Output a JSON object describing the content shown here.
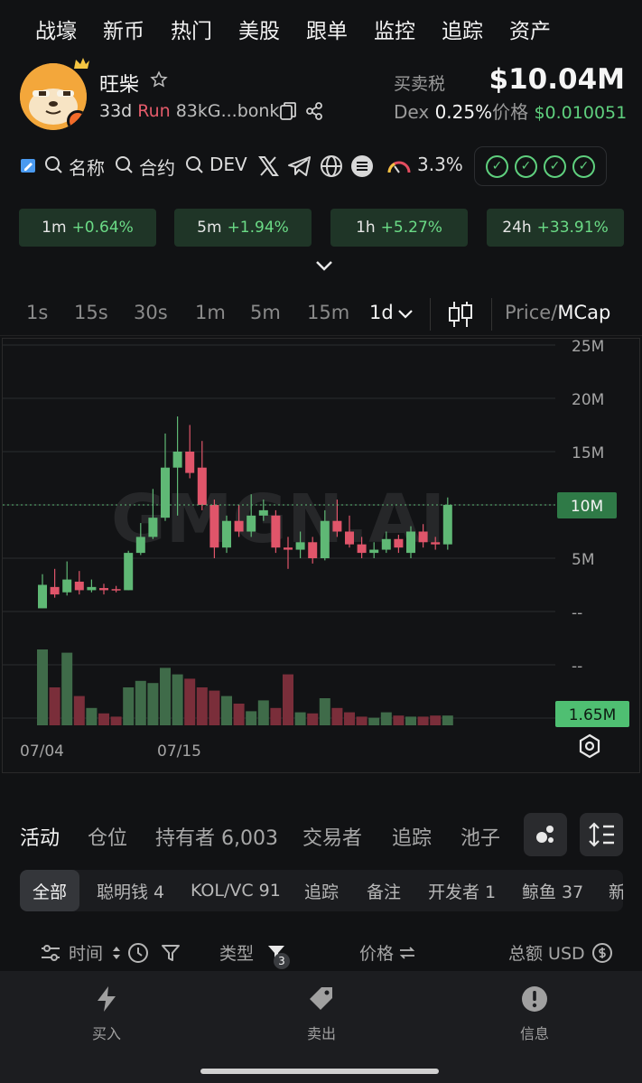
{
  "nav": [
    "战壕",
    "新币",
    "热门",
    "美股",
    "跟单",
    "监控",
    "追踪",
    "资产"
  ],
  "token": {
    "name": "旺柴",
    "age": "33d",
    "status": "Run",
    "address": "83kG...bonk",
    "tax_label": "买卖税",
    "market_cap": "$10.04M",
    "dex_label": "Dex",
    "dex_tax": "0.25%",
    "price_label": "价格",
    "price": "$0.010051"
  },
  "links": {
    "search_name": "名称",
    "search_contract": "合约",
    "search_dev": "DEV",
    "risk_pct": "3.3%",
    "checks": [
      "✓",
      "✓",
      "✓",
      "✓"
    ]
  },
  "changes": [
    {
      "tf": "1m",
      "val": "+0.64%"
    },
    {
      "tf": "5m",
      "val": "+1.94%"
    },
    {
      "tf": "1h",
      "val": "+5.27%"
    },
    {
      "tf": "24h",
      "val": "+33.91%"
    }
  ],
  "timeframes": [
    "1s",
    "15s",
    "30s",
    "1m",
    "5m",
    "15m",
    "1d"
  ],
  "price_toggle": {
    "price": "Price/",
    "mcap": "MCap"
  },
  "chart_data": {
    "type": "candlestick",
    "watermark": "GMGN.AI",
    "y_ticks": [
      "25M",
      "20M",
      "15M",
      "10M",
      "5M",
      "--",
      "--"
    ],
    "current_label": "10M",
    "volume_label": "1.65M",
    "x_ticks": [
      "07/04",
      "07/15"
    ],
    "ylim": [
      -5,
      26
    ],
    "candles": [
      {
        "o": 0.3,
        "c": 2.5,
        "h": 3.5,
        "l": 0.3
      },
      {
        "o": 2.3,
        "c": 1.6,
        "h": 4.0,
        "l": 1.3
      },
      {
        "o": 1.8,
        "c": 3.0,
        "h": 4.7,
        "l": 1.5
      },
      {
        "o": 2.8,
        "c": 2.0,
        "h": 3.8,
        "l": 1.6
      },
      {
        "o": 2.0,
        "c": 2.3,
        "h": 3.0,
        "l": 1.8
      },
      {
        "o": 2.2,
        "c": 2.0,
        "h": 2.6,
        "l": 1.6
      },
      {
        "o": 2.1,
        "c": 2.0,
        "h": 2.4,
        "l": 1.8
      },
      {
        "o": 2.0,
        "c": 5.5,
        "h": 5.7,
        "l": 2.0
      },
      {
        "o": 5.5,
        "c": 7.0,
        "h": 8.3,
        "l": 5.3
      },
      {
        "o": 7.0,
        "c": 8.8,
        "h": 11.5,
        "l": 6.8
      },
      {
        "o": 8.8,
        "c": 13.5,
        "h": 16.7,
        "l": 8.5
      },
      {
        "o": 13.5,
        "c": 15.0,
        "h": 18.3,
        "l": 9.0
      },
      {
        "o": 15.0,
        "c": 13.0,
        "h": 17.5,
        "l": 12.5
      },
      {
        "o": 13.5,
        "c": 10.0,
        "h": 16.0,
        "l": 9.5
      },
      {
        "o": 10.0,
        "c": 6.0,
        "h": 10.5,
        "l": 5.0
      },
      {
        "o": 6.0,
        "c": 8.5,
        "h": 9.0,
        "l": 5.5
      },
      {
        "o": 8.5,
        "c": 7.5,
        "h": 10.0,
        "l": 7.0
      },
      {
        "o": 7.5,
        "c": 9.0,
        "h": 11.0,
        "l": 7.0
      },
      {
        "o": 9.0,
        "c": 9.5,
        "h": 10.5,
        "l": 8.5
      },
      {
        "o": 9.0,
        "c": 6.0,
        "h": 9.5,
        "l": 5.5
      },
      {
        "o": 6.0,
        "c": 5.8,
        "h": 7.0,
        "l": 4.0
      },
      {
        "o": 5.8,
        "c": 6.5,
        "h": 7.5,
        "l": 5.0
      },
      {
        "o": 6.5,
        "c": 5.0,
        "h": 7.0,
        "l": 4.5
      },
      {
        "o": 5.0,
        "c": 8.5,
        "h": 9.5,
        "l": 4.8
      },
      {
        "o": 8.5,
        "c": 7.5,
        "h": 10.5,
        "l": 7.0
      },
      {
        "o": 7.5,
        "c": 6.3,
        "h": 9.0,
        "l": 6.0
      },
      {
        "o": 6.3,
        "c": 5.5,
        "h": 7.0,
        "l": 5.0
      },
      {
        "o": 5.5,
        "c": 5.8,
        "h": 6.5,
        "l": 5.0
      },
      {
        "o": 5.8,
        "c": 6.8,
        "h": 7.5,
        "l": 5.5
      },
      {
        "o": 6.8,
        "c": 6.0,
        "h": 7.2,
        "l": 5.5
      },
      {
        "o": 5.5,
        "c": 7.5,
        "h": 8.0,
        "l": 5.0
      },
      {
        "o": 7.5,
        "c": 6.5,
        "h": 8.2,
        "l": 6.0
      },
      {
        "o": 6.5,
        "c": 6.3,
        "h": 7.0,
        "l": 5.8
      },
      {
        "o": 6.3,
        "c": 10.0,
        "h": 10.7,
        "l": 5.8
      }
    ],
    "volumes": [
      7,
      3.5,
      6.7,
      2.7,
      1.6,
      1.1,
      0.8,
      3.5,
      4.1,
      3.9,
      5.3,
      4.7,
      4.3,
      3.5,
      3.2,
      2.7,
      2.0,
      1.3,
      2.3,
      1.6,
      4.7,
      1.2,
      1.1,
      2.5,
      1.6,
      1.2,
      0.8,
      0.7,
      1.2,
      0.9,
      0.8,
      0.8,
      0.9,
      0.9
    ]
  },
  "tabs": {
    "activity": "活动",
    "positions": "仓位",
    "holders": "持有者 6,003",
    "traders": "交易者",
    "tracking": "追踪",
    "pools": "池子"
  },
  "filters": [
    "全部",
    "聪明钱 4",
    "KOL/VC 91",
    "追踪",
    "备注",
    "开发者 1",
    "鲸鱼 37",
    "新"
  ],
  "columns": {
    "time": "时间",
    "type": "类型",
    "type_badge": "3",
    "price": "价格",
    "total": "总额 USD"
  },
  "bottom": {
    "buy": "买入",
    "sell": "卖出",
    "info": "信息"
  }
}
